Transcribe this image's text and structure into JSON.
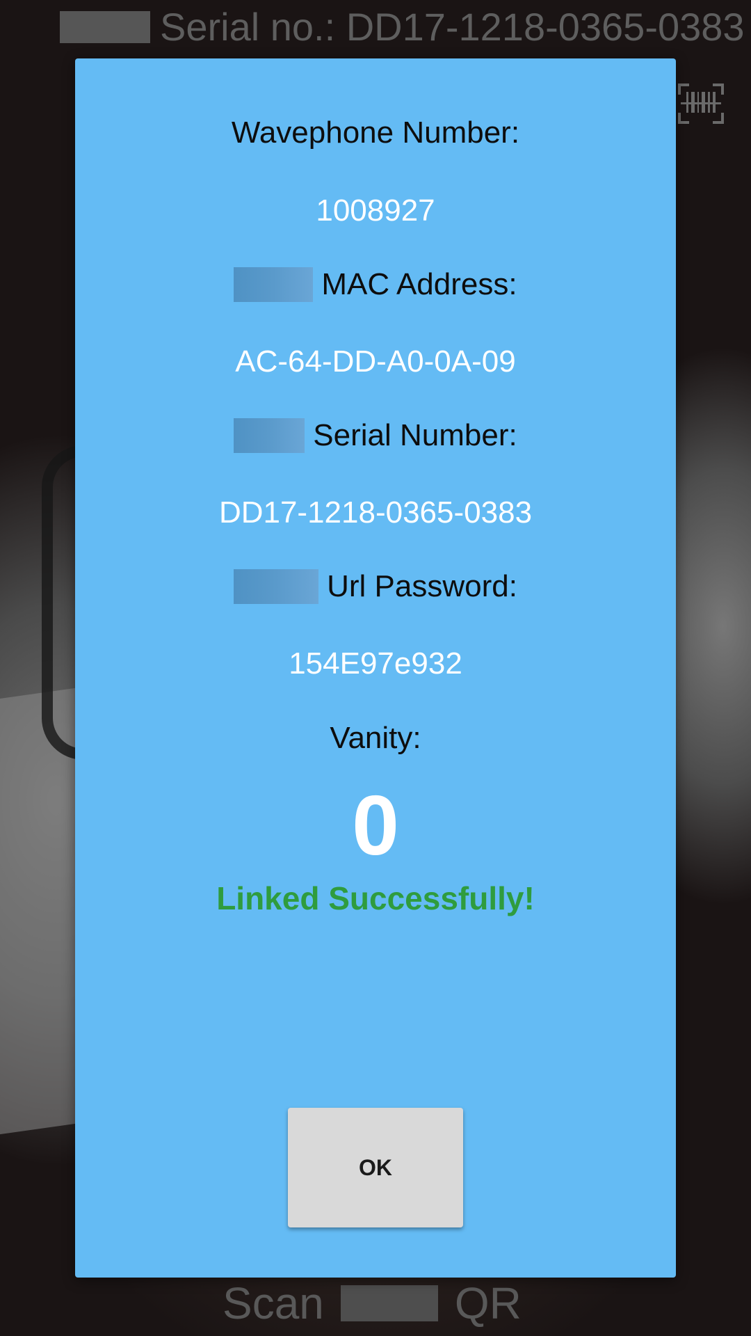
{
  "background": {
    "top_text": "Serial no.: DD17-1218-0365-0383",
    "bottom_text_left": "Scan",
    "bottom_text_right": "QR",
    "barcode_icon": "barcode-scanner-icon"
  },
  "dialog": {
    "wavephone_label": "Wavephone Number:",
    "wavephone_value": "1008927",
    "mac_label": "MAC Address:",
    "mac_value": "AC-64-DD-A0-0A-09",
    "serial_label": "Serial Number:",
    "serial_value": "DD17-1218-0365-0383",
    "password_label": "Url Password:",
    "password_value": "154E97e932",
    "vanity_label": "Vanity:",
    "vanity_value": "0",
    "status_text": "Linked Successfully!",
    "ok_label": "OK"
  },
  "colors": {
    "dialog_bg": "#64bbf4",
    "status_green": "#2f9c3e",
    "button_bg": "#d9d9d9"
  }
}
